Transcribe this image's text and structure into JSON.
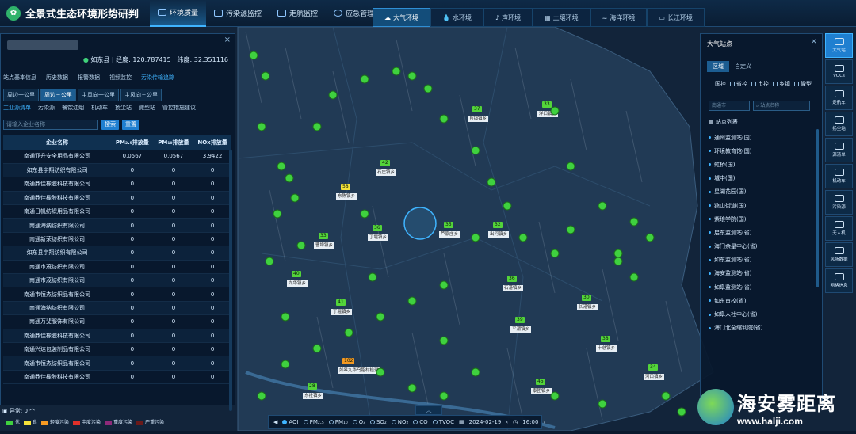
{
  "app": {
    "title": "全景式生态环境形势研判"
  },
  "nav": [
    {
      "label": "环境质量",
      "active": true
    },
    {
      "label": "污染源监控",
      "active": false
    },
    {
      "label": "走航监控",
      "active": false
    },
    {
      "label": "应急管理",
      "active": false
    }
  ],
  "env_tabs": [
    {
      "label": "大气环境",
      "active": true
    },
    {
      "label": "水环境",
      "active": false
    },
    {
      "label": "声环境",
      "active": false
    },
    {
      "label": "土壤环境",
      "active": false
    },
    {
      "label": "海洋环境",
      "active": false
    },
    {
      "label": "长江环境",
      "active": false
    }
  ],
  "left_panel": {
    "coords": "如东县 | 经度: 120.787415 | 纬度: 32.351116",
    "info_tabs": [
      "站点基本信息",
      "历史数据",
      "报警数据",
      "视频监控",
      "污染传输追踪"
    ],
    "info_tab_active": 4,
    "road_tabs": [
      "周边一公里",
      "周边三公里",
      "主风向一公里",
      "主风向三公里"
    ],
    "road_tab_active": 1,
    "source_tabs": [
      "工业源清单",
      "污染源",
      "餐饮油烟",
      "机动车",
      "扬尘站",
      "微型站",
      "管控措施建议"
    ],
    "source_tab_active": 0,
    "search_placeholder": "请输入企业名称",
    "search_button": "搜索",
    "reset_button": "重置",
    "columns": [
      "企业名称",
      "PM₂.₅排放量",
      "PM₁₀排放量",
      "NOx排放量"
    ],
    "rows": [
      [
        "南通亚升安全用品有限公司",
        "0.0567",
        "0.0567",
        "3.9422"
      ],
      [
        "如东县宇翔纺织有限公司",
        "0",
        "0",
        "0"
      ],
      [
        "南通鼎佳橡胶科技有限公司",
        "0",
        "0",
        "0"
      ],
      [
        "南通鼎佳橡胶科技有限公司",
        "0",
        "0",
        "0"
      ],
      [
        "南通日帆纺织用品有限公司",
        "0",
        "0",
        "0"
      ],
      [
        "南通海纳纺织有限公司",
        "0",
        "0",
        "0"
      ],
      [
        "南通新荣纺织有限公司",
        "0",
        "0",
        "0"
      ],
      [
        "如东县宇翔纺织有限公司",
        "0",
        "0",
        "0"
      ],
      [
        "南通市茂纺织有限公司",
        "0",
        "0",
        "0"
      ],
      [
        "南通市茂纺织有限公司",
        "0",
        "0",
        "0"
      ],
      [
        "南通市恒杰纺织品有限公司",
        "0",
        "0",
        "0"
      ],
      [
        "南通海纳纺织有限公司",
        "0",
        "0",
        "0"
      ],
      [
        "南通万斐服饰有限公司",
        "0",
        "0",
        "0"
      ],
      [
        "南通鼎佳橡胶科技有限公司",
        "0",
        "0",
        "0"
      ],
      [
        "南通兴达包装制品有限公司",
        "0",
        "0",
        "0"
      ],
      [
        "南通市恒杰纺织品有限公司",
        "0",
        "0",
        "0"
      ],
      [
        "南通鼎佳橡胶科技有限公司",
        "0",
        "0",
        "0"
      ]
    ]
  },
  "legend": {
    "anomaly": "异常: 0 个",
    "levels": [
      {
        "label": "优",
        "color": "#3fd13f"
      },
      {
        "label": "良",
        "color": "#f5e33a"
      },
      {
        "label": "轻度污染",
        "color": "#f59a23"
      },
      {
        "label": "中度污染",
        "color": "#e0302a"
      },
      {
        "label": "重度污染",
        "color": "#8e2a7a"
      },
      {
        "label": "严重污染",
        "color": "#6a1a1a"
      }
    ]
  },
  "bottom_bar": {
    "pollutants": [
      "AQI",
      "PM₂.₅",
      "PM₁₀",
      "O₃",
      "SO₂",
      "NO₂",
      "CO",
      "TVOC"
    ],
    "selected": 0,
    "date": "2024-02-19",
    "time": "16:00"
  },
  "right_panel": {
    "title": "大气站点",
    "tabs": [
      "区域",
      "自定义"
    ],
    "tab_active": 0,
    "checks": [
      "国控",
      "省控",
      "市控",
      "乡镇",
      "微型"
    ],
    "select_placeholder": "南通市",
    "search_placeholder": "站点名称",
    "list_header": "站点列表",
    "sites": [
      "通州监测站(国)",
      "环境教育馆(国)",
      "虹桥(国)",
      "城中(国)",
      "星湖花园(国)",
      "狼山街道(国)",
      "紫琅学院(国)",
      "启东监测站(省)",
      "海门余星中心(省)",
      "如东监测站(省)",
      "海安监测站(省)",
      "如皋监测站(省)",
      "如东审校(省)",
      "如皋人社中心(省)",
      "海门北全缩利院(省)"
    ]
  },
  "sidebar": [
    {
      "label": "大气站",
      "active": true
    },
    {
      "label": "VOCs",
      "active": false
    },
    {
      "label": "走航车",
      "active": false
    },
    {
      "label": "扬尘站",
      "active": false
    },
    {
      "label": "源清单",
      "active": false
    },
    {
      "label": "机动车",
      "active": false
    },
    {
      "label": "污染源",
      "active": false
    },
    {
      "label": "无人机",
      "active": false
    },
    {
      "label": "风场数据",
      "active": false
    },
    {
      "label": "网格信息",
      "active": false
    }
  ],
  "map": {
    "markers": [
      {
        "value": "58",
        "label": "东陈镇乡",
        "color": "#f5e33a"
      },
      {
        "value": "102",
        "label": "如皋九华乌脂村检测",
        "color": "#f59a23"
      },
      {
        "value": "40",
        "label": "九华镇乡",
        "color": "#53d43a"
      },
      {
        "value": "45",
        "label": "泰团镇乡",
        "color": "#53d43a"
      },
      {
        "value": "35",
        "label": "芦家庄乡",
        "color": "#53d43a"
      },
      {
        "value": "36",
        "label": "丁堰镇乡",
        "color": "#53d43a"
      },
      {
        "value": "32",
        "label": "出河镇乡",
        "color": "#53d43a"
      },
      {
        "value": "30",
        "label": "长港镇乡",
        "color": "#53d43a"
      },
      {
        "value": "38",
        "label": "十总镇乡",
        "color": "#53d43a"
      },
      {
        "value": "33",
        "label": "曹埠镇乡",
        "color": "#53d43a"
      },
      {
        "value": "36",
        "label": "石港镇乡",
        "color": "#53d43a"
      },
      {
        "value": "41",
        "label": "丁堰镇乡",
        "color": "#53d43a"
      },
      {
        "value": "39",
        "label": "平潮镇乡",
        "color": "#53d43a"
      },
      {
        "value": "28",
        "label": "东社镇乡",
        "color": "#53d43a"
      },
      {
        "value": "33",
        "label": "洋口镇乡",
        "color": "#53d43a"
      },
      {
        "value": "37",
        "label": "苴镇镇乡",
        "color": "#53d43a"
      },
      {
        "value": "42",
        "label": "石庄镇乡",
        "color": "#53d43a"
      },
      {
        "value": "34",
        "label": "河口镇乡",
        "color": "#53d43a"
      }
    ]
  },
  "watermark": {
    "text": "海安雾距离",
    "url": "www.halji.com"
  }
}
